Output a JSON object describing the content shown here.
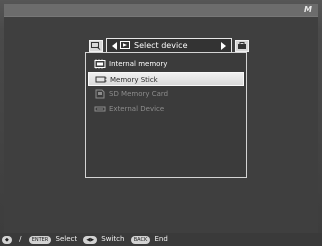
{
  "header": {
    "brand_mark": "M"
  },
  "dialog": {
    "title": "Select device",
    "items": [
      {
        "label": "Internal memory",
        "state": "enabled",
        "icon": "internal-memory-icon"
      },
      {
        "label": "Memory Stick",
        "state": "selected",
        "icon": "memory-stick-icon"
      },
      {
        "label": "SD Memory Card",
        "state": "disabled",
        "icon": "sd-card-icon"
      },
      {
        "label": "External Device",
        "state": "disabled",
        "icon": "external-device-icon"
      }
    ]
  },
  "footer": {
    "slash": "/",
    "enter_key": "ENTER",
    "select_label": "Select",
    "switch_label": "Switch",
    "back_key": "BACK",
    "end_label": "End"
  },
  "colors": {
    "background": "#3f3f3f",
    "panel_border": "#d4d4d4",
    "selected_bg": "#e5e5e5",
    "text_enabled": "#ffffff",
    "text_disabled": "#8c8c8c",
    "text_selected": "#2d2d2d"
  }
}
